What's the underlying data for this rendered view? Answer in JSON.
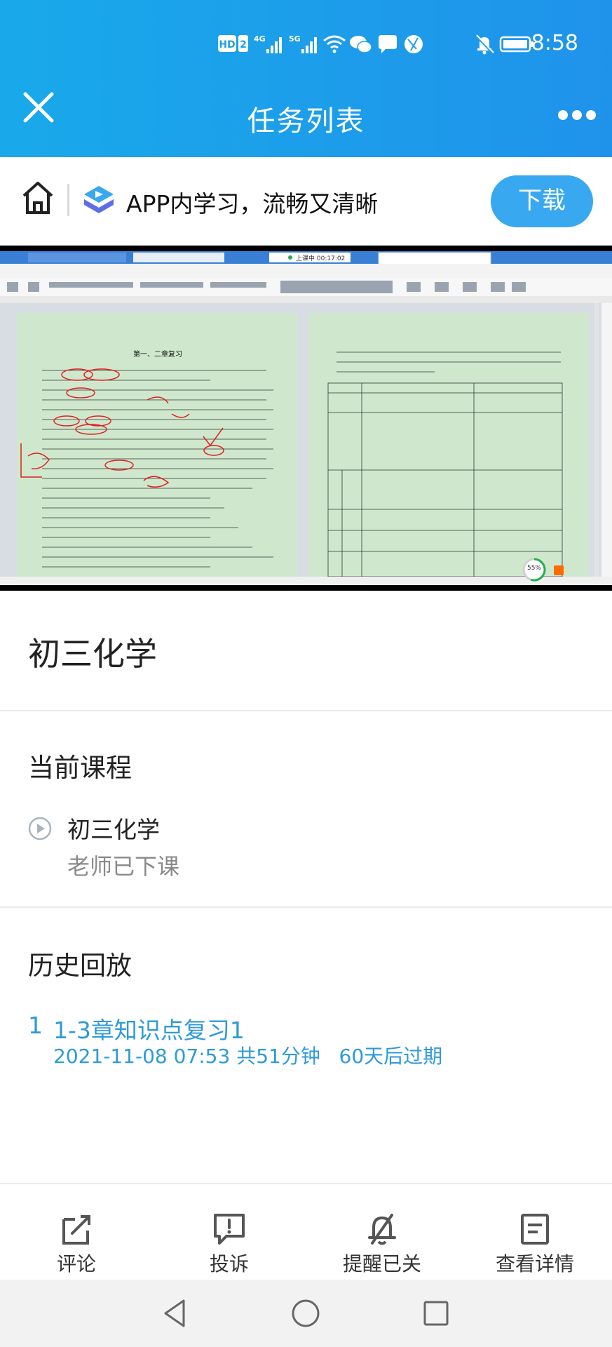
{
  "status_bar": {
    "time": "8:58",
    "network_badges": [
      "HD",
      "2",
      "4G",
      "5G"
    ],
    "icons": [
      "wifi-icon",
      "wechat-icon",
      "chat-bubble-icon",
      "globe-app-icon",
      "mute-bell-icon",
      "battery-icon"
    ]
  },
  "header": {
    "title": "任务列表",
    "close_icon": "close-icon",
    "more_icon": "more-dots-icon"
  },
  "banner": {
    "text": "APP内学习，流畅又清晰",
    "download_label": "下载",
    "home_icon": "home-icon",
    "logo_icon": "app-logo-icon"
  },
  "video": {
    "doc_title": "第一、二章复习",
    "recording_badge": "上课中 00:17:02",
    "progress_badge": "55%",
    "progress_fraction": 0.55
  },
  "course": {
    "title": "初三化学"
  },
  "current": {
    "section_title": "当前课程",
    "name": "初三化学",
    "status": "老师已下课"
  },
  "history": {
    "section_title": "历史回放",
    "items": [
      {
        "index": "1",
        "title": "1-3章知识点复习1",
        "meta": "2021-11-08 07:53 共51分钟   60天后过期"
      }
    ]
  },
  "actions": [
    {
      "label": "评论",
      "icon": "edit-comment-icon"
    },
    {
      "label": "投诉",
      "icon": "complaint-icon"
    },
    {
      "label": "提醒已关",
      "icon": "reminder-off-icon"
    },
    {
      "label": "查看详情",
      "icon": "details-icon"
    }
  ],
  "system_nav": [
    "back-icon",
    "home-circle-icon",
    "recents-icon"
  ],
  "colors": {
    "header_bg": "#1fa0ea",
    "accent": "#2e9ad8",
    "download_button": "#38a8f0",
    "muted_text": "#8a8a8a"
  }
}
